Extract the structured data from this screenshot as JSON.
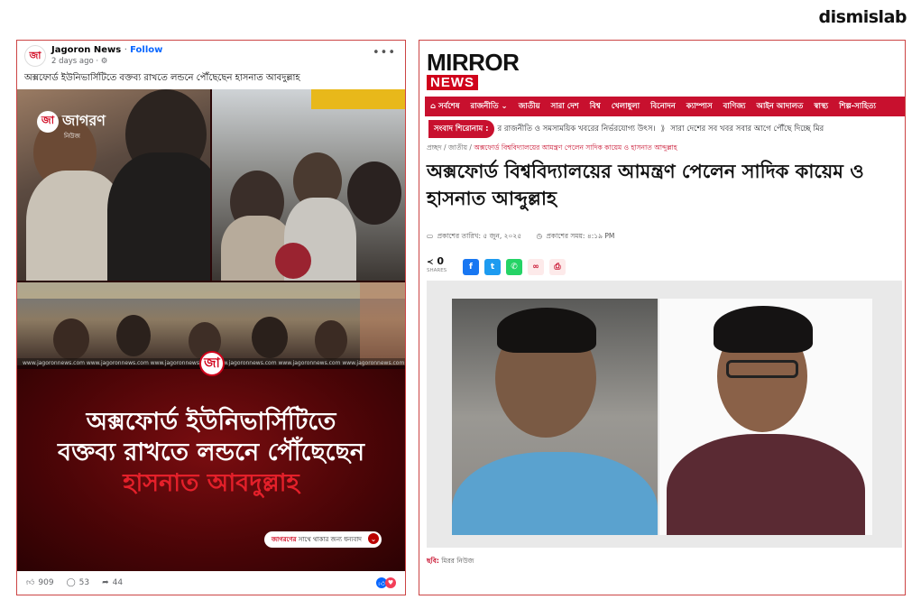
{
  "brand": "dismislab",
  "facebook_post": {
    "page_name": "Jagoron News",
    "follow_label": "Follow",
    "time": "2 days ago",
    "caption": "অক্সফোর্ড ইউনিভার্সিটিতে বক্তব্য রাখতে লন্ডনে পৌঁছেছেন হাসনাত আবদুল্লাহ",
    "image": {
      "logo_text": "জাগরণ",
      "logo_sub": "নিউজ",
      "logo_mark": "জা",
      "watermark": "www.jagoronnews.com   www.jagoronnews.com   www.jagoronnews.com   www.jagoronnews.com   www.jagoronnews.com   www.jagoronnews.com",
      "headline_line1": "অক্সফোর্ড ইউনিভার্সিটিতে",
      "headline_line2": "বক্তব্য রাখতে লন্ডনে পৌঁছেছেন",
      "headline_line3": "হাসনাত আবদুল্লাহ",
      "thanks_prefix": "জাগরণের",
      "thanks_rest": "সাথে থাকার জন্য ধন্যবাদ"
    },
    "reactions": "909",
    "comments": "53",
    "shares": "44"
  },
  "mirror_news": {
    "logo_top": "MIRROR",
    "logo_bottom": "NEWS",
    "nav": [
      "⌂ সর্বশেষ",
      "রাজনীতি ⌄",
      "জাতীয়",
      "সারা দেশ",
      "বিশ্ব",
      "খেলাধুলা",
      "বিনোদন",
      "ক্যাম্পাস",
      "বাণিজ্য",
      "আইন আদালত",
      "স্বাস্থ্য",
      "শিল্প-সাহিত্য"
    ],
    "ticker_label": "সংবাদ শিরোনাম :",
    "ticker_items": [
      "র রাজনীতি ও সমসাময়িক খবরের নির্ভরযোগ্য উৎস।",
      "সারা দেশের সব খবর সবার আগে পৌঁছে দিচ্ছে মির"
    ],
    "breadcrumb": [
      "প্রচ্ছদ",
      "জাতীয়",
      "অক্সফোর্ড বিশ্ববিদ্যালয়ের আমন্ত্রণ পেলেন সাদিক কায়েম ও হাসনাত আব্দুল্লাহ"
    ],
    "title": "অক্সফোর্ড বিশ্ববিদ্যালয়ের আমন্ত্রণ পেলেন সাদিক কায়েম ও হাসনাত আব্দুল্লাহ",
    "published_date": "প্রকাশের তারিখ: ৫ জুন, ২০২৫",
    "published_time": "প্রকাশের সময়: ৪:১৯ PM",
    "share_count": "0",
    "share_label": "SHARES",
    "photo_credit_label": "ছবি:",
    "photo_credit": "মিরর নিউজ"
  },
  "colors": {
    "brand_red": "#c8102e",
    "facebook_blue": "#0866ff"
  }
}
